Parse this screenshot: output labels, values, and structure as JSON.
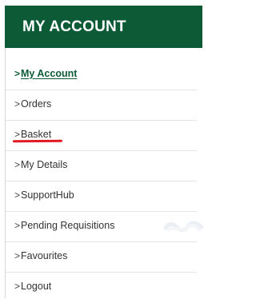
{
  "header": {
    "title": "MY ACCOUNT",
    "background_color": "#0c5b36"
  },
  "menu": {
    "chevron_glyph": ">",
    "items": [
      {
        "label": "My Account",
        "active": true
      },
      {
        "label": "Orders",
        "active": false
      },
      {
        "label": "Basket",
        "active": false,
        "annotated": true,
        "annotation_color": "#e01a22"
      },
      {
        "label": "My Details",
        "active": false
      },
      {
        "label": "SupportHub",
        "active": false
      },
      {
        "label": "Pending Requisitions",
        "active": false
      },
      {
        "label": "Favourites",
        "active": false
      },
      {
        "label": "Logout",
        "active": false
      }
    ]
  }
}
